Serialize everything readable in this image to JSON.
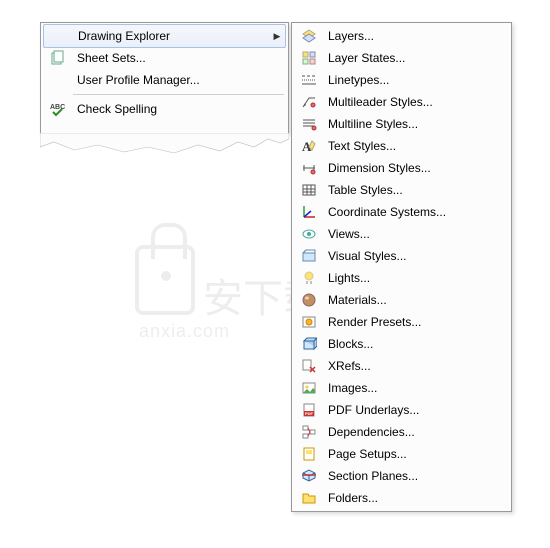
{
  "left_menu": {
    "items": [
      {
        "label": "Drawing Explorer",
        "icon": "",
        "highlighted": true,
        "has_submenu": true
      },
      {
        "label": "Sheet Sets...",
        "icon": "sheets-icon"
      },
      {
        "label": "User Profile Manager...",
        "icon": ""
      },
      {
        "separator": true
      },
      {
        "label": "Check Spelling",
        "icon": "spellcheck-icon"
      }
    ]
  },
  "right_menu": {
    "items": [
      {
        "label": "Layers...",
        "icon": "layers-icon"
      },
      {
        "label": "Layer States...",
        "icon": "layer-states-icon"
      },
      {
        "label": "Linetypes...",
        "icon": "linetypes-icon"
      },
      {
        "label": "Multileader Styles...",
        "icon": "multileader-icon"
      },
      {
        "label": "Multiline Styles...",
        "icon": "multiline-icon"
      },
      {
        "label": "Text Styles...",
        "icon": "text-styles-icon"
      },
      {
        "label": "Dimension Styles...",
        "icon": "dimension-icon"
      },
      {
        "label": "Table Styles...",
        "icon": "table-icon"
      },
      {
        "label": "Coordinate Systems...",
        "icon": "coordinate-icon"
      },
      {
        "label": "Views...",
        "icon": "views-icon"
      },
      {
        "label": "Visual Styles...",
        "icon": "visual-styles-icon"
      },
      {
        "label": "Lights...",
        "icon": "lights-icon"
      },
      {
        "label": "Materials...",
        "icon": "materials-icon"
      },
      {
        "label": "Render Presets...",
        "icon": "render-icon"
      },
      {
        "label": "Blocks...",
        "icon": "blocks-icon"
      },
      {
        "label": "XRefs...",
        "icon": "xrefs-icon"
      },
      {
        "label": "Images...",
        "icon": "images-icon"
      },
      {
        "label": "PDF Underlays...",
        "icon": "pdf-icon"
      },
      {
        "label": "Dependencies...",
        "icon": "dependencies-icon"
      },
      {
        "label": "Page Setups...",
        "icon": "page-setups-icon"
      },
      {
        "label": "Section Planes...",
        "icon": "section-icon"
      },
      {
        "label": "Folders...",
        "icon": "folders-icon"
      }
    ]
  },
  "watermark": {
    "cn": "安下载",
    "en": "anxia.com"
  }
}
